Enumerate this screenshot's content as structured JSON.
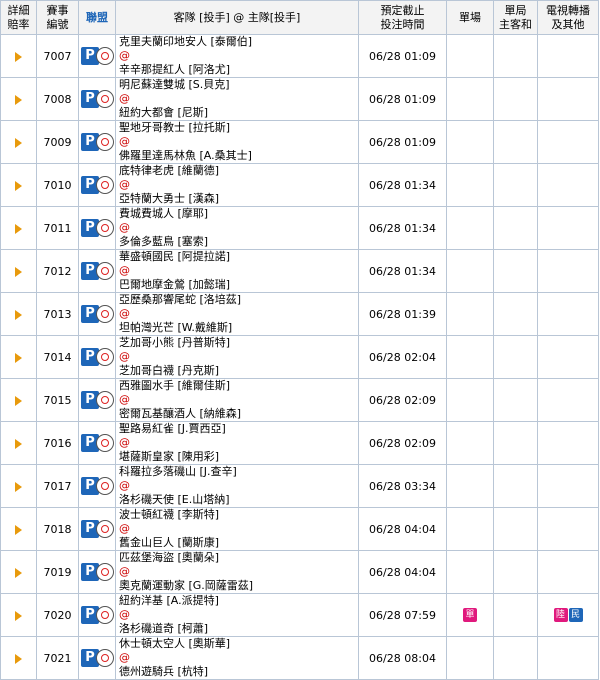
{
  "header": {
    "detail": [
      "詳細",
      "賠率"
    ],
    "match_no": [
      "賽事",
      "編號"
    ],
    "league": "聯盟",
    "teams": "客隊 [投手] @ 主隊[投手]",
    "time": [
      "預定截止",
      "投注時間"
    ],
    "single": "單場",
    "bureau": [
      "單局",
      "主客和"
    ],
    "tv": [
      "電視轉播",
      "及其他"
    ]
  },
  "icons": {
    "detail": "play-arrow-icon",
    "league": "baseball-league-icon"
  },
  "colors": {
    "border": "#b9c6d6",
    "header_bg": "#f3f3f3",
    "league_text": "#1e66b8",
    "arrow": "#e89a0c",
    "at": "#cc0000"
  },
  "rows": [
    {
      "no": "7007",
      "away": "克里夫蘭印地安人 [泰爾伯]",
      "at": "@",
      "home": "辛辛那提紅人 [阿洛尤]",
      "time": "06/28 01:09"
    },
    {
      "no": "7008",
      "away": "明尼蘇達雙城 [S.貝克]",
      "at": "@",
      "home": "紐約大都會 [尼斯]",
      "time": "06/28 01:09"
    },
    {
      "no": "7009",
      "away": "聖地牙哥教士 [拉托斯]",
      "at": "@",
      "home": "佛羅里達馬林魚 [A.桑其士]",
      "time": "06/28 01:09"
    },
    {
      "no": "7010",
      "away": "底特律老虎 [維蘭德]",
      "at": "@",
      "home": "亞特蘭大勇士 [漢森]",
      "time": "06/28 01:34"
    },
    {
      "no": "7011",
      "away": "費城費城人 [摩耶]",
      "at": "@",
      "home": "多倫多藍鳥 [塞索]",
      "time": "06/28 01:34"
    },
    {
      "no": "7012",
      "away": "華盛頓國民 [阿提拉諾]",
      "at": "@",
      "home": "巴爾地摩金鶯 [加懿瑞]",
      "time": "06/28 01:34"
    },
    {
      "no": "7013",
      "away": "亞歷桑那響尾蛇 [洛培茲]",
      "at": "@",
      "home": "坦帕灣光芒 [W.戴維斯]",
      "time": "06/28 01:39"
    },
    {
      "no": "7014",
      "away": "芝加哥小熊 [丹普斯特]",
      "at": "@",
      "home": "芝加哥白襪 [丹克斯]",
      "time": "06/28 02:04"
    },
    {
      "no": "7015",
      "away": "西雅圖水手 [維爾佳斯]",
      "at": "@",
      "home": "密爾瓦基釀酒人 [納維森]",
      "time": "06/28 02:09"
    },
    {
      "no": "7016",
      "away": "聖路易紅雀 [J.賈西亞]",
      "at": "@",
      "home": "堪薩斯皇家 [陳用彩]",
      "time": "06/28 02:09"
    },
    {
      "no": "7017",
      "away": "科羅拉多落磯山 [J.查辛]",
      "at": "@",
      "home": "洛杉磯天使 [E.山塔納]",
      "time": "06/28 03:34"
    },
    {
      "no": "7018",
      "away": "波士頓紅襪 [李斯特]",
      "at": "@",
      "home": "舊金山巨人 [蘭斯康]",
      "time": "06/28 04:04"
    },
    {
      "no": "7019",
      "away": "匹茲堡海盜 [奧蘭朵]",
      "at": "@",
      "home": "奧克蘭運動家 [G.岡薩雷茲]",
      "time": "06/28 04:04"
    },
    {
      "no": "7020",
      "away": "紐約洋基 [A.派提特]",
      "at": "@",
      "home": "洛杉磯道奇 [柯蕭]",
      "time": "06/28 07:59",
      "single": "單",
      "tv": [
        "陸",
        "民"
      ]
    },
    {
      "no": "7021",
      "away": "休士頓太空人 [奧斯華]",
      "at": "@",
      "home": "德州遊騎兵 [杭特]",
      "time": "06/28 08:04"
    }
  ]
}
